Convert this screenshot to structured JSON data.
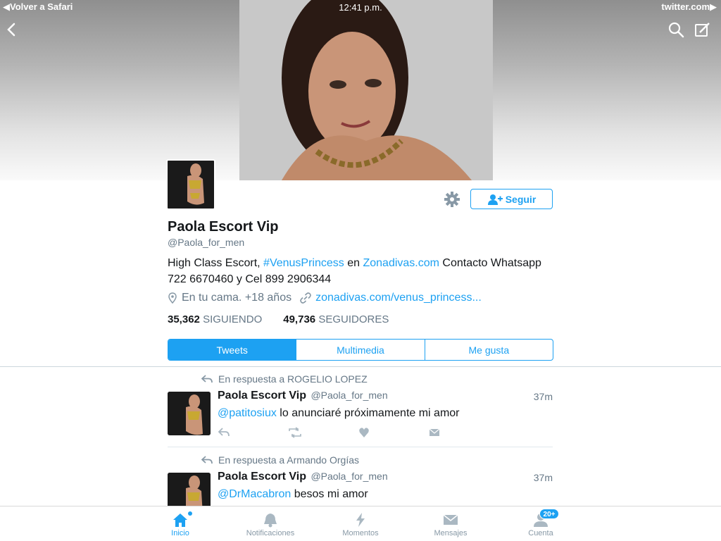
{
  "status_bar": {
    "back_label": "Volver a Safari",
    "time": "12:41 p.m.",
    "site": "twitter.com"
  },
  "profile": {
    "name": "Paola Escort Vip",
    "handle": "@Paola_for_men",
    "bio": {
      "part1": "High Class Escort, ",
      "hashtag": "#VenusPrincess",
      "part2": " en ",
      "site": "Zonadivas.com",
      "part3": " Contacto Whatsapp 722 6670460 y Cel 899 2906344"
    },
    "location": "En tu cama. +18 años",
    "url": "zonadivas.com/venus_princess...",
    "following_count": "35,362",
    "following_label": "SIGUIENDO",
    "followers_count": "49,736",
    "followers_label": "SEGUIDORES",
    "follow_button": "Seguir"
  },
  "tabs": [
    {
      "label": "Tweets",
      "active": true
    },
    {
      "label": "Multimedia",
      "active": false
    },
    {
      "label": "Me gusta",
      "active": false
    }
  ],
  "tweets": [
    {
      "reply_to": "En respuesta a ROGELIO LOPEZ",
      "name": "Paola Escort Vip",
      "handle": "@Paola_for_men",
      "time": "37m",
      "mention": "@patitosiux",
      "text": " lo anunciaré próximamente mi amor"
    },
    {
      "reply_to": "En respuesta a Armando Orgías",
      "name": "Paola Escort Vip",
      "handle": "@Paola_for_men",
      "time": "37m",
      "mention": "@DrMacabron",
      "text": " besos mi amor"
    }
  ],
  "tabbar": [
    {
      "label": "Inicio",
      "icon": "home-icon",
      "active": true
    },
    {
      "label": "Notificaciones",
      "icon": "bell-icon",
      "active": false
    },
    {
      "label": "Momentos",
      "icon": "lightning-icon",
      "active": false
    },
    {
      "label": "Mensajes",
      "icon": "envelope-icon",
      "active": false
    },
    {
      "label": "Cuenta",
      "icon": "person-icon",
      "active": false
    }
  ],
  "account_badge": "20+",
  "colors": {
    "accent": "#1da1f2",
    "text": "#14171a",
    "muted": "#657786"
  }
}
